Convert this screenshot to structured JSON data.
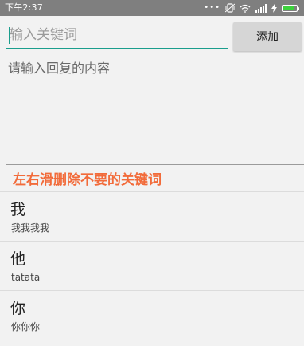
{
  "status_bar": {
    "time": "下午2:37",
    "icons": [
      "dots-icon",
      "vibrate-icon",
      "wifi-icon",
      "signal-icon",
      "charging-icon",
      "battery-icon"
    ],
    "battery_level": 0.85,
    "battery_color": "#3dd13d",
    "background": "#7f7f7f"
  },
  "keyword_input": {
    "placeholder": "输入关键词",
    "value": "",
    "underline_color": "#1b9e8d"
  },
  "add_button": {
    "label": "添加"
  },
  "reply_input": {
    "placeholder": "请输入回复的内容",
    "value": ""
  },
  "hint": {
    "text": "左右滑删除不要的关键词",
    "color": "#f26b3a"
  },
  "keywords": [
    {
      "keyword": "我",
      "reply": "我我我我"
    },
    {
      "keyword": "他",
      "reply": "tatata"
    },
    {
      "keyword": "你",
      "reply": "你你你"
    }
  ]
}
